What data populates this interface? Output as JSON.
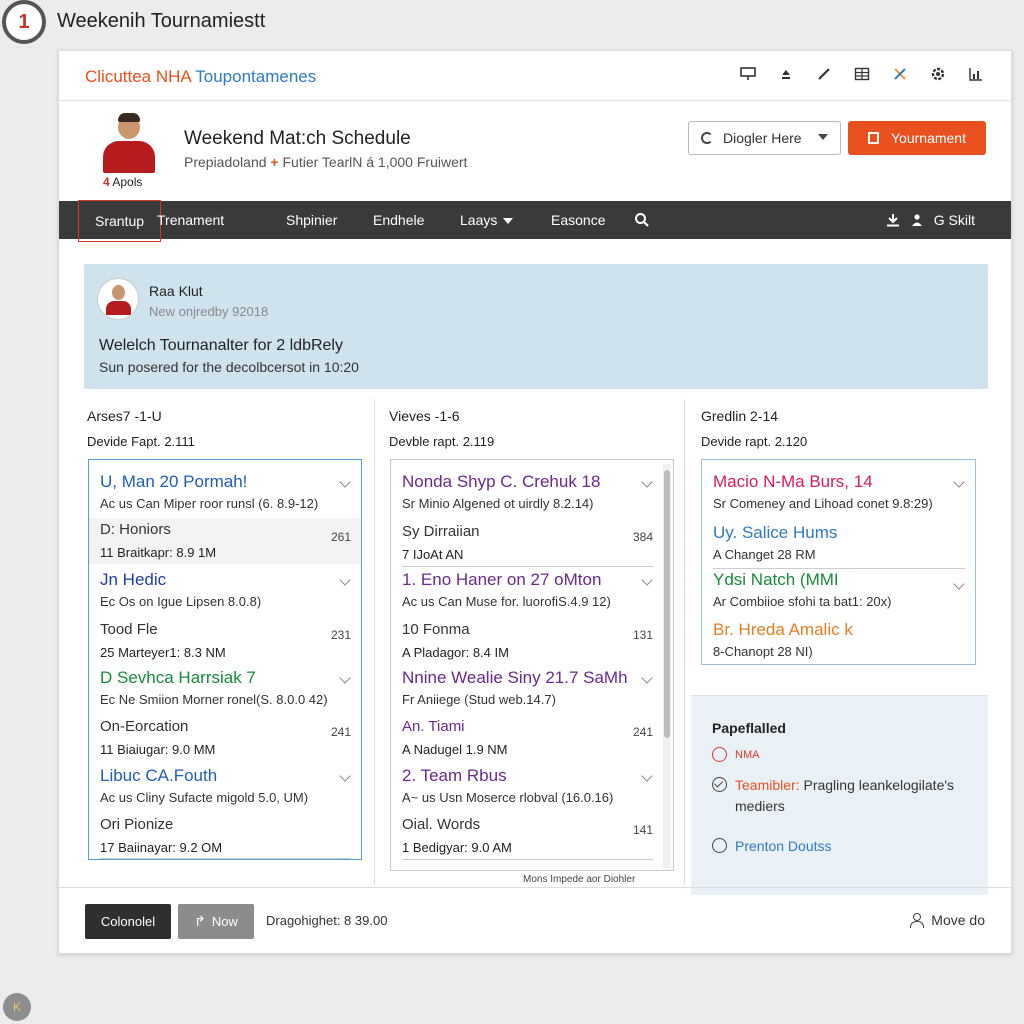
{
  "window": {
    "title": "Weekenih Tournamiestt",
    "logo": "1"
  },
  "topbar": {
    "brand_part1": "Clicuttea NHA",
    "brand_part2": "Toupontamenes",
    "icons": [
      "presentation-icon",
      "eject-icon",
      "pencil-icon",
      "grid-icon",
      "tools-icon",
      "settings-icon",
      "chart-icon"
    ]
  },
  "header": {
    "avatar_label_num": "4",
    "avatar_label": "Apols",
    "title": "Weekend Mat:ch Schedule",
    "subtitle_part1": "Prepiadoland",
    "subtitle_plus": "+",
    "subtitle_part2": "Futier TearlN á 1,000 Fruiwert",
    "dropdown_value": "Diogler Here",
    "tournament_button": "Yournament"
  },
  "nav": {
    "items": [
      "Srantup",
      "Trenament",
      "Shpinier",
      "Endhele",
      "Laays",
      "Easonce"
    ],
    "right_label": "G Skilt"
  },
  "announcement": {
    "name": "Raa Klut",
    "meta": "New onjredby 92018",
    "title": "Welelch Tournanalter for 2 ldbRely",
    "body": "Sun posered for the decolbcersot in 10:20"
  },
  "columns": [
    {
      "head": "Arses7 -1-U",
      "sub": "Devide Fapt. 2.111",
      "rows": [
        {
          "title": "U, Man 20 Pormah!",
          "color": "#1f5fb0",
          "detail": "Ac us Can Miper roor runsl (6. 8.9-12)"
        },
        {
          "title": "D: Honiors",
          "num": "261",
          "detail": "11 Braitkapr: 8.9 1M"
        },
        {
          "title": "Jn Hedic",
          "color": "#1f3fa0",
          "detail": "Ec Os on Igue Lipsen 8.0.8)"
        },
        {
          "title": "Tood Fle",
          "num": "231",
          "detail": "25 Marteyer1: 8.3 NM"
        },
        {
          "title": "D Sevhca Harrsiak 7",
          "color": "#1a8a3c",
          "detail": "Ec Ne Smiion Morner ronel(S. 8.0.0 42)"
        },
        {
          "title": "On-Eorcation",
          "num": "241",
          "detail": "11 Biaiugar: 9.0 MM"
        },
        {
          "title": "Libuc CA.Fouth",
          "color": "#1f5fb0",
          "detail": "Ac us Cliny Sufacte migold 5.0, UM)"
        },
        {
          "title": "Ori Pionize",
          "num": "",
          "detail": "17 Baiinayar: 9.2 OM"
        }
      ]
    },
    {
      "head": "Vieves -1-6",
      "sub": "Devble rapt. 2.119",
      "rows": [
        {
          "title": "Nonda Shyp C. Crehuk 18",
          "color": "#6a2a8a",
          "detail": "Sr Minio Algened ot uirdly 8.2.14)"
        },
        {
          "title": "Sy Dirraiian",
          "num": "384",
          "detail": "7 IJoAt AN"
        },
        {
          "title": "1. Eno Haner on 27 oMton",
          "color": "#6a2a8a",
          "detail": "Ac us Can Muse for. luorofiS.4.9 12)"
        },
        {
          "title": "10 Fonma",
          "num": "131",
          "detail": "A Pladagor: 8.4 IM"
        },
        {
          "title": "Nnine Wealie Siny 21.7 SaMh",
          "color": "#6a2a8a",
          "detail": "Fr Aniiege (Stud web.14.7)"
        },
        {
          "title": "An. Tiami",
          "num": "241",
          "detail": "A Nadugel 1.9 NM",
          "title_color": "#6a2a8a"
        },
        {
          "title": "2. Team Rbus",
          "color": "#6a2a8a",
          "detail": "A~ us Usn Moserce rlobval (16.0.16)"
        },
        {
          "title": "Oial. Words",
          "num": "141",
          "detail": "1 Bedigyar: 9.0 AM"
        }
      ],
      "footer_note": "Mons Impede aor Diohler"
    },
    {
      "head": "Gredlin 2-14",
      "sub": "Devide rapt. 2.120",
      "rows": [
        {
          "title": "Macio N-Ma Burs, 14",
          "color": "#d81b60",
          "detail": "Sr Comeney and Lihoad conet 9.8:29)"
        },
        {
          "title": "Uy. Salice Hums",
          "color": "#2f7bbf",
          "detail": "A Changet 28 RM"
        },
        {
          "title": "Ydsi Natch (MMI",
          "color": "#1a8a3c",
          "detail": "Ar Combiioe sfohi ta bat1: 20x)"
        },
        {
          "title": "Br. Hreda Amalic k",
          "color": "#e67e22",
          "detail": "8-Chanopt 28 NI)"
        }
      ]
    }
  ],
  "panel": {
    "title": "Papeflalled",
    "options": [
      {
        "label": "NMA",
        "color": "#d23a2a"
      },
      {
        "label_prefix": "Teamibler:",
        "label": "Pragling leankelogilate's mediers",
        "color": "#e8501e"
      },
      {
        "label": "Prenton Doutss",
        "color": "#2f7bbf"
      }
    ]
  },
  "footer": {
    "dark_button": "Colonolel",
    "grey_button": "Now",
    "text": "Dragohighet: 8 39.00",
    "move_label": "Move do"
  },
  "corner_badge": "K"
}
